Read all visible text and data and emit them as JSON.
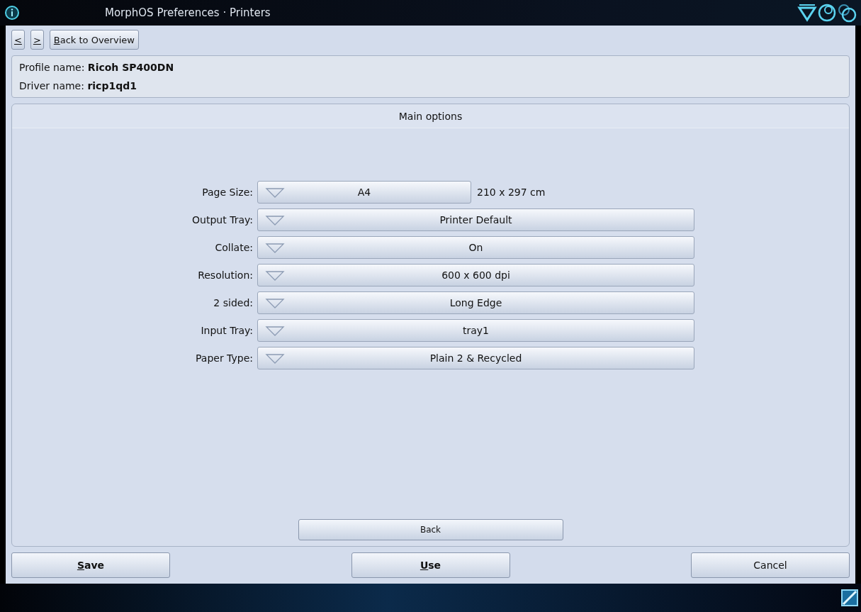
{
  "window": {
    "title": "MorphOS Preferences · Printers"
  },
  "nav": [
    {
      "label": "<",
      "mnemonic": true
    },
    {
      "label": ">",
      "mnemonic": true
    },
    {
      "label": "Back to Overview",
      "mnemonic": true
    }
  ],
  "profile": [
    {
      "label": "Profile name:",
      "value": "Ricoh SP400DN"
    },
    {
      "label": "Driver name:",
      "value": "ricp1qd1"
    }
  ],
  "tab": {
    "label": "Main options"
  },
  "options": [
    {
      "label": "Page Size:",
      "value": "A4",
      "note": "210 x 297 cm"
    },
    {
      "label": "Output Tray:",
      "value": "Printer Default"
    },
    {
      "label": "Collate:",
      "value": "On"
    },
    {
      "label": "Resolution:",
      "value": "600 x 600 dpi"
    },
    {
      "label": "2 sided:",
      "value": "Long Edge"
    },
    {
      "label": "Input Tray:",
      "value": "tray1"
    },
    {
      "label": "Paper Type:",
      "value": "Plain 2 & Recycled"
    }
  ],
  "back_button": {
    "label": "Back"
  },
  "buttons": [
    {
      "label": "Save",
      "mnemonic": true,
      "bold": true
    },
    {
      "label": "Use",
      "mnemonic": true,
      "bold": true
    },
    {
      "label": "Cancel",
      "mnemonic": false,
      "bold": false
    }
  ]
}
